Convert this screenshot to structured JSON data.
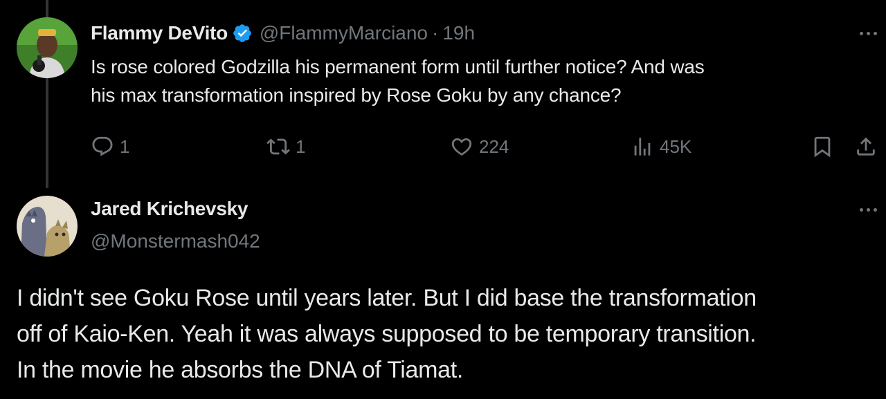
{
  "colors": {
    "background": "#000000",
    "primary_text": "#e7e9ea",
    "secondary_text": "#71767b",
    "verified_badge": "#1d9bf0",
    "thread_line": "#333639"
  },
  "parent_tweet": {
    "author_name": "Flammy DeVito",
    "verified": true,
    "verified_icon": "verified-badge-icon",
    "handle": "@FlammyMarciano",
    "separator": "·",
    "timestamp": "19h",
    "text_line1": "Is rose colored Godzilla his permanent form until further notice? And was",
    "text_line2": "his max transformation inspired by Rose Goku by any chance?",
    "actions": {
      "reply_icon": "reply-icon",
      "reply_count": "1",
      "retweet_icon": "retweet-icon",
      "retweet_count": "1",
      "like_icon": "heart-icon",
      "like_count": "224",
      "views_icon": "views-chart-icon",
      "views_count": "45K",
      "bookmark_icon": "bookmark-icon",
      "share_icon": "share-icon"
    }
  },
  "reply_tweet": {
    "author_name": "Jared Krichevsky",
    "handle": "@Monstermash042",
    "text_line1": "I didn't see Goku Rose until years later. But I did base the transformation",
    "text_line2": "off of Kaio-Ken. Yeah it was always supposed to be temporary transition.",
    "text_line3": "In the movie he absorbs the DNA of Tiamat."
  }
}
